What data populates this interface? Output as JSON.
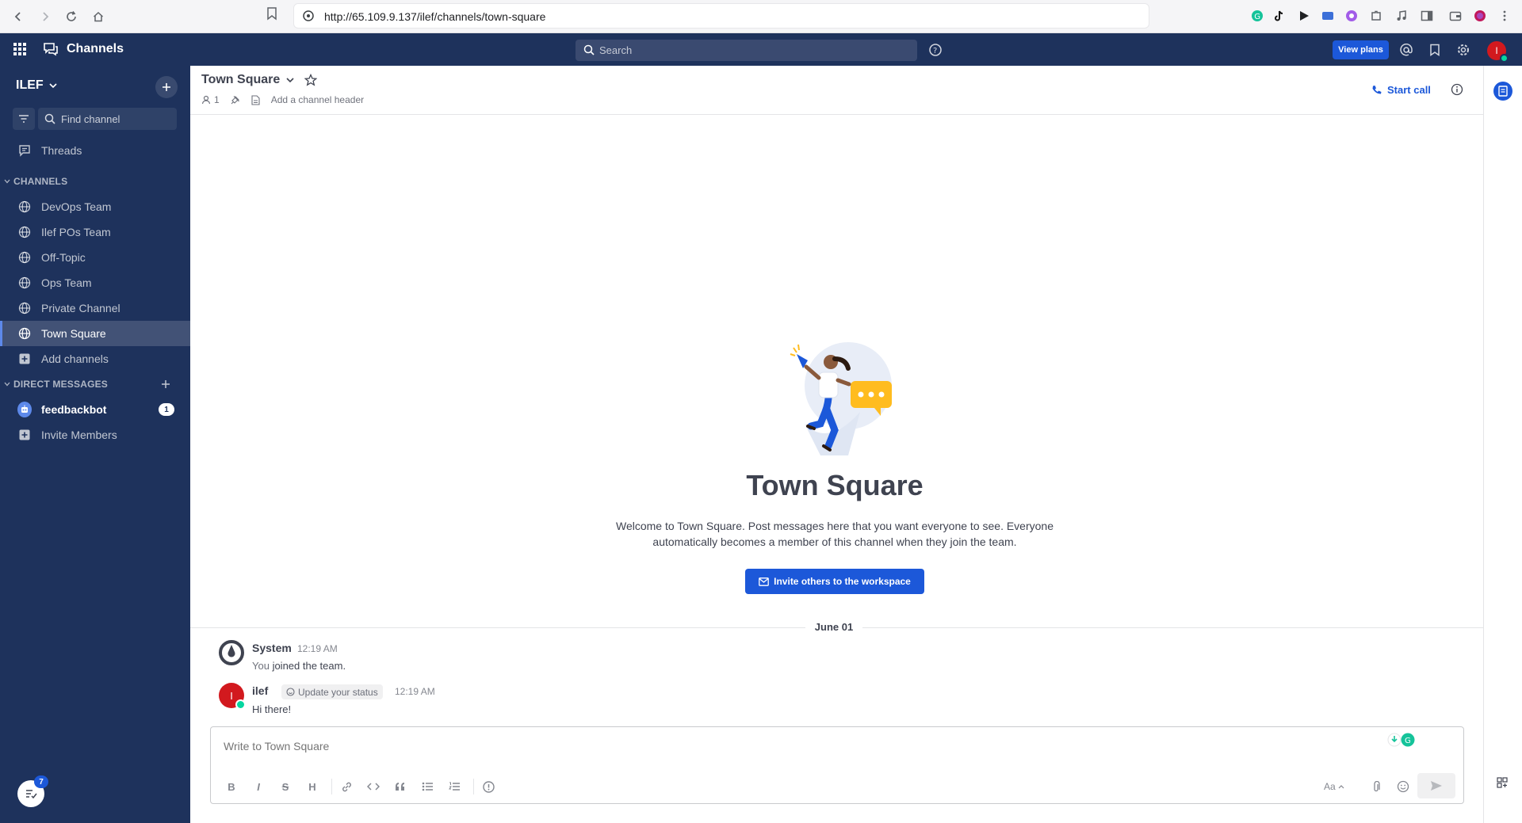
{
  "browser": {
    "url": "http://65.109.9.137/ilef/channels/town-square"
  },
  "header": {
    "product": "Channels",
    "search_placeholder": "Search",
    "view_plans": "View plans",
    "avatar_initial": "I"
  },
  "sidebar": {
    "team_name": "ILEF",
    "find_channel_placeholder": "Find channel",
    "threads": "Threads",
    "channels_heading": "CHANNELS",
    "channels": [
      {
        "label": "DevOps Team"
      },
      {
        "label": "Ilef POs Team"
      },
      {
        "label": "Off-Topic"
      },
      {
        "label": "Ops Team"
      },
      {
        "label": "Private Channel"
      },
      {
        "label": "Town Square"
      }
    ],
    "add_channels": "Add channels",
    "dm_heading": "DIRECT MESSAGES",
    "dms": [
      {
        "label": "feedbackbot",
        "unread": "1"
      }
    ],
    "invite_members": "Invite Members",
    "launcher_count": "7"
  },
  "channel": {
    "name": "Town Square",
    "member_count": "1",
    "header_placeholder": "Add a channel header",
    "start_call": "Start call"
  },
  "intro": {
    "title": "Town Square",
    "description": "Welcome to Town Square. Post messages here that you want everyone to see. Everyone automatically becomes a member of this channel when they join the team.",
    "invite_button": "Invite others to the workspace"
  },
  "date_separator": "June 01",
  "posts": [
    {
      "user": "System",
      "time": "12:19 AM",
      "message_prefix": "You",
      "message": "joined the team."
    },
    {
      "user": "ilef",
      "avatar_initial": "I",
      "status_chip": "Update your status",
      "time": "12:19 AM",
      "message": "Hi there!"
    }
  ],
  "composer": {
    "placeholder": "Write to Town Square",
    "format_buttons": [
      "B",
      "I",
      "S",
      "H"
    ],
    "aa_label": "Aa"
  },
  "colors": {
    "sidebar_bg": "#1e325c",
    "accent": "#1c58d9",
    "online": "#06d6a0",
    "avatar_red": "#d2191e"
  }
}
